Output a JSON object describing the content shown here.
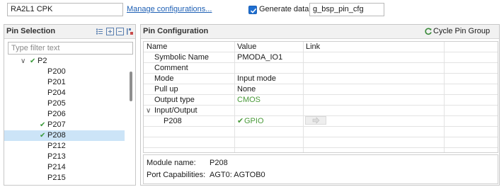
{
  "top": {
    "config_value": "RA2L1 CPK",
    "manage_link": "Manage configurations...",
    "generate_label": "Generate data:",
    "generate_checked": true,
    "generate_value": "g_bsp_pin_cfg"
  },
  "pin_selection": {
    "title": "Pin Selection",
    "filter_placeholder": "Type filter text",
    "toolbar_icons": [
      "expand-all-icon",
      "collapse-all-icon",
      "filter-icon",
      "sort-icon"
    ],
    "tree": [
      {
        "label": "P2",
        "level": 1,
        "expanded": true,
        "configured": true,
        "selected": false
      },
      {
        "label": "P200",
        "level": 2,
        "configured": false,
        "selected": false
      },
      {
        "label": "P201",
        "level": 2,
        "configured": false,
        "selected": false
      },
      {
        "label": "P204",
        "level": 2,
        "configured": false,
        "selected": false
      },
      {
        "label": "P205",
        "level": 2,
        "configured": false,
        "selected": false
      },
      {
        "label": "P206",
        "level": 2,
        "configured": false,
        "selected": false
      },
      {
        "label": "P207",
        "level": 2,
        "configured": true,
        "selected": false
      },
      {
        "label": "P208",
        "level": 2,
        "configured": true,
        "selected": true
      },
      {
        "label": "P212",
        "level": 2,
        "configured": false,
        "selected": false
      },
      {
        "label": "P213",
        "level": 2,
        "configured": false,
        "selected": false
      },
      {
        "label": "P214",
        "level": 2,
        "configured": false,
        "selected": false
      },
      {
        "label": "P215",
        "level": 2,
        "configured": false,
        "selected": false
      }
    ]
  },
  "pin_configuration": {
    "title": "Pin Configuration",
    "cycle_label": "Cycle Pin Group",
    "columns": [
      "Name",
      "Value",
      "Link"
    ],
    "rows": [
      {
        "name": "Symbolic Name",
        "value": "PMODA_IO1",
        "status": "normal"
      },
      {
        "name": "Comment",
        "value": "",
        "status": "normal"
      },
      {
        "name": "Mode",
        "value": "Input mode",
        "status": "normal"
      },
      {
        "name": "Pull up",
        "value": "None",
        "status": "normal"
      },
      {
        "name": "Output type",
        "value": "CMOS",
        "status": "default"
      },
      {
        "name": "Input/Output",
        "value": "",
        "status": "group"
      },
      {
        "name": "P208",
        "value": "GPIO",
        "status": "ok"
      }
    ],
    "module_name_label": "Module name:",
    "module_name": "P208",
    "port_capabilities_label": "Port Capabilities:",
    "port_capabilities": "AGT0: AGTOB0"
  },
  "colors": {
    "accent": "#1f6fd1",
    "link": "#1d5fb4",
    "selection": "#cce4f7",
    "ok_green": "#4a9a3a"
  }
}
